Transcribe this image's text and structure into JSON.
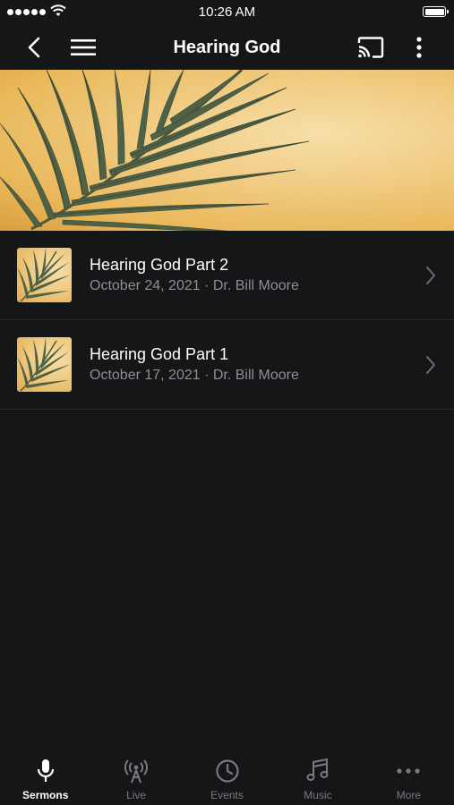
{
  "status_bar": {
    "time": "10:26 AM"
  },
  "nav": {
    "title": "Hearing God",
    "icons": [
      "back-icon",
      "menu-icon",
      "cast-icon",
      "more-vertical-icon"
    ]
  },
  "hero": {
    "image": "palm-leaf-artwork"
  },
  "sermons": [
    {
      "title": "Hearing God Part 2",
      "subtitle": "October 24, 2021 · Dr. Bill Moore"
    },
    {
      "title": "Hearing God Part 1",
      "subtitle": "October 17, 2021 · Dr. Bill Moore"
    }
  ],
  "tabs": [
    {
      "label": "Sermons",
      "icon": "microphone-icon",
      "active": true
    },
    {
      "label": "Live",
      "icon": "broadcast-icon",
      "active": false
    },
    {
      "label": "Events",
      "icon": "clock-icon",
      "active": false
    },
    {
      "label": "Music",
      "icon": "music-note-icon",
      "active": false
    },
    {
      "label": "More",
      "icon": "more-horizontal-icon",
      "active": false
    }
  ],
  "colors": {
    "background": "#151618",
    "text_primary": "#ffffff",
    "text_secondary": "#8e8e93",
    "tab_inactive": "#7a7a7e",
    "divider": "#2a2b2e"
  }
}
